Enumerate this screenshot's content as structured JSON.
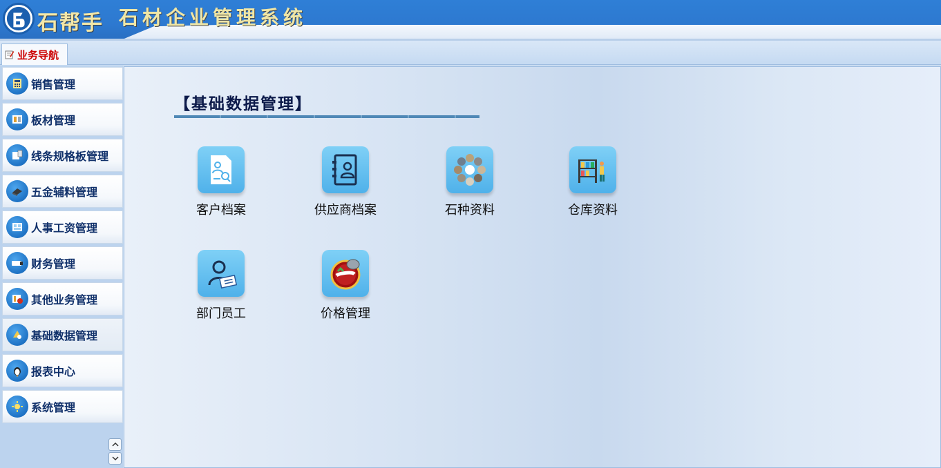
{
  "header": {
    "logo_text": "石帮手",
    "system_title": "石材企业管理系统"
  },
  "tabs": [
    {
      "label": "业务导航",
      "icon": "edit-document-icon",
      "active": true
    }
  ],
  "sidebar": {
    "items": [
      {
        "label": "销售管理",
        "icon": "calculator-icon",
        "active": false
      },
      {
        "label": "板材管理",
        "icon": "panel-icon",
        "active": false
      },
      {
        "label": "线条规格板管理",
        "icon": "ruler-board-icon",
        "active": false
      },
      {
        "label": "五金辅料管理",
        "icon": "hardware-icon",
        "active": false
      },
      {
        "label": "人事工资管理",
        "icon": "personnel-icon",
        "active": false
      },
      {
        "label": "财务管理",
        "icon": "finance-icon",
        "active": false
      },
      {
        "label": "其他业务管理",
        "icon": "other-business-icon",
        "active": false
      },
      {
        "label": "基础数据管理",
        "icon": "basic-data-icon",
        "active": true
      },
      {
        "label": "报表中心",
        "icon": "report-icon",
        "active": false
      },
      {
        "label": "系统管理",
        "icon": "system-settings-icon",
        "active": false
      }
    ]
  },
  "main": {
    "section_title": "【基础数据管理】",
    "tiles": [
      {
        "label": "客户档案",
        "icon": "customer-file-icon"
      },
      {
        "label": "供应商档案",
        "icon": "supplier-file-icon"
      },
      {
        "label": "石种资料",
        "icon": "stone-types-icon"
      },
      {
        "label": "仓库资料",
        "icon": "warehouse-icon"
      },
      {
        "label": "部门员工",
        "icon": "department-staff-icon"
      },
      {
        "label": "价格管理",
        "icon": "price-management-icon"
      }
    ]
  },
  "colors": {
    "header_blue": "#2d79d0",
    "tab_label_red": "#cc0000",
    "sidebar_label_navy": "#10306a",
    "tile_blue": "#4fb1ea"
  }
}
